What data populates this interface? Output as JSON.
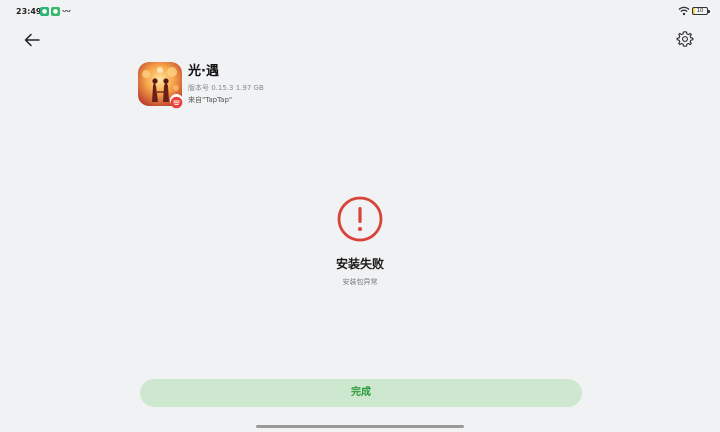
{
  "status_bar": {
    "time": "23:49",
    "notification_icons": [
      "green-app-icon",
      "green-app-icon",
      "wave-icon"
    ],
    "battery_level": "10",
    "wifi_icon": "wifi-icon"
  },
  "header": {
    "back_icon": "arrow-left-icon",
    "settings_icon": "gear-icon"
  },
  "app": {
    "name": "光·遇",
    "version_line": "版本号 0.15.3  1.97 GB",
    "source_line": "来自\"TapTap\"",
    "icon": "sky-game-icon",
    "badge_icon": "netease-badge-icon"
  },
  "result": {
    "icon": "error-exclamation-icon",
    "title": "安装失败",
    "subtitle": "安装包异常",
    "accent_color": "#d9443a"
  },
  "actions": {
    "done_label": "完成",
    "done_bg_color": "#cde8cf",
    "done_text_color": "#2c9b3a"
  }
}
